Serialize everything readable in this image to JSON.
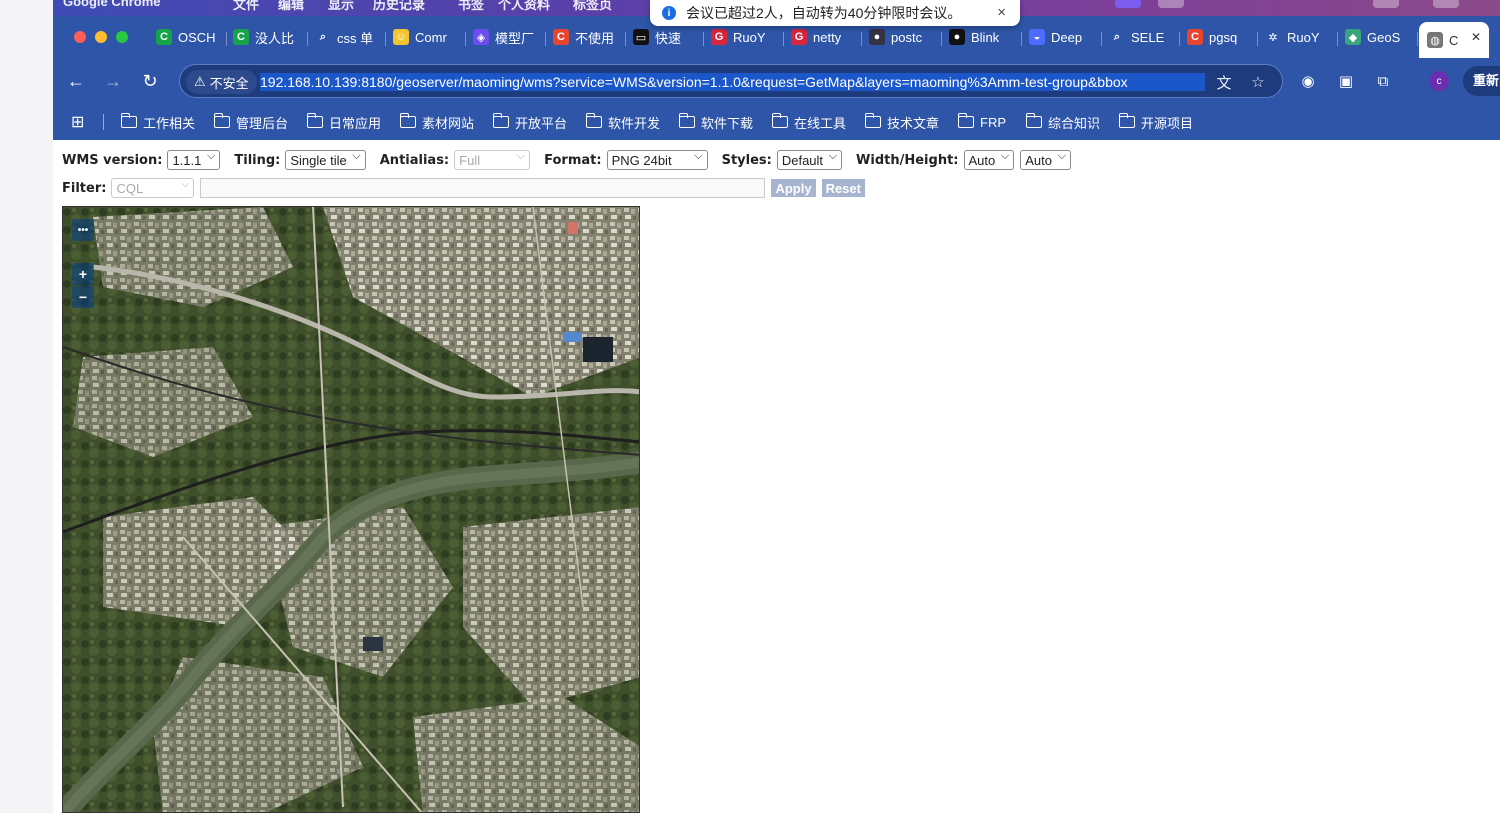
{
  "menubar": {
    "items": [
      "Google Chrome",
      "文件",
      "编辑",
      "显示",
      "历史记录",
      "书签",
      "个人资料",
      "标签页"
    ]
  },
  "notification": {
    "text": "会议已超过2人，自动转为40分钟限时会议。",
    "close": "×",
    "info": "i"
  },
  "tabs": [
    {
      "label": "OSCH",
      "icon": "C",
      "color": "#16a34a"
    },
    {
      "label": "没人比",
      "icon": "C",
      "color": "#16a34a"
    },
    {
      "label": "css 单",
      "icon": "search-icon",
      "color": "#2e55a8"
    },
    {
      "label": "Comr",
      "icon": "face-icon",
      "color": "#f4c430"
    },
    {
      "label": "模型厂",
      "icon": "bot-icon",
      "color": "#6d4cf0"
    },
    {
      "label": "不使用",
      "icon": "C",
      "color": "#e8452e"
    },
    {
      "label": "快速",
      "icon": "terminal-icon",
      "color": "#111"
    },
    {
      "label": "RuoY",
      "icon": "G",
      "color": "#d7263d"
    },
    {
      "label": "netty",
      "icon": "G",
      "color": "#d7263d"
    },
    {
      "label": "postc",
      "icon": "db-icon",
      "color": "#334"
    },
    {
      "label": "Blink",
      "icon": "dot-icon",
      "color": "#111"
    },
    {
      "label": "Deep",
      "icon": "whale-icon",
      "color": "#4d6bfe"
    },
    {
      "label": "SELE",
      "icon": "search-icon",
      "color": "#2e55a8"
    },
    {
      "label": "pgsq",
      "icon": "C",
      "color": "#e8452e"
    },
    {
      "label": "RuoY",
      "icon": "gear-icon",
      "color": "#2e55a8"
    },
    {
      "label": "GeoS",
      "icon": "geo-icon",
      "color": "#3aa57a"
    },
    {
      "label": "C",
      "icon": "globe-icon",
      "color": "#777"
    }
  ],
  "toolbar": {
    "security_label": "不安全",
    "url": "192.168.10.139:8180/geoserver/maoming/wms?service=WMS&version=1.1.0&request=GetMap&layers=maoming%3Amm-test-group&bbox",
    "relaunch_label": "重新",
    "profile_initial": "c"
  },
  "bookmarks": [
    "工作相关",
    "管理后台",
    "日常应用",
    "素材网站",
    "开放平台",
    "软件开发",
    "软件下载",
    "在线工具",
    "技术文章",
    "FRP",
    "综合知识",
    "开源项目"
  ],
  "controls": {
    "wms_version_label": "WMS version:",
    "wms_version": "1.1.1",
    "tiling_label": "Tiling:",
    "tiling": "Single tile",
    "antialias_label": "Antialias:",
    "antialias": "Full",
    "format_label": "Format:",
    "format": "PNG 24bit",
    "styles_label": "Styles:",
    "styles": "Default",
    "wh_label": "Width/Height:",
    "width": "Auto",
    "height": "Auto",
    "filter_label": "Filter:",
    "filter_type": "CQL",
    "filter_value": "",
    "apply_label": "Apply",
    "reset_label": "Reset"
  },
  "map": {
    "toolbar_button": "•••",
    "zoom_in": "+",
    "zoom_out": "−"
  }
}
